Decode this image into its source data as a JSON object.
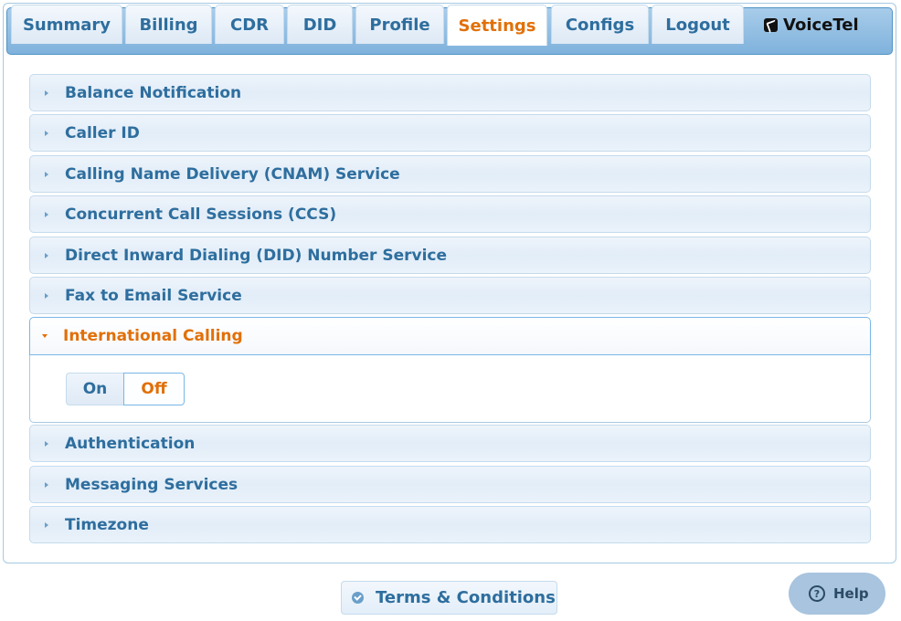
{
  "nav": {
    "tabs": [
      {
        "label": "Summary",
        "active": false
      },
      {
        "label": "Billing",
        "active": false
      },
      {
        "label": "CDR",
        "active": false
      },
      {
        "label": "DID",
        "active": false
      },
      {
        "label": "Profile",
        "active": false
      },
      {
        "label": "Settings",
        "active": true
      },
      {
        "label": "Configs",
        "active": false
      },
      {
        "label": "Logout",
        "active": false
      }
    ],
    "brand": "VoiceTel",
    "brand_icon": "phone-icon"
  },
  "settings": {
    "sections": [
      {
        "title": "Balance Notification",
        "expanded": false
      },
      {
        "title": "Caller ID",
        "expanded": false
      },
      {
        "title": "Calling Name Delivery (CNAM) Service",
        "expanded": false
      },
      {
        "title": "Concurrent Call Sessions (CCS)",
        "expanded": false
      },
      {
        "title": "Direct Inward Dialing (DID) Number Service",
        "expanded": false
      },
      {
        "title": "Fax to Email Service",
        "expanded": false
      },
      {
        "title": "International Calling",
        "expanded": true
      },
      {
        "title": "Authentication",
        "expanded": false
      },
      {
        "title": "Messaging Services",
        "expanded": false
      },
      {
        "title": "Timezone",
        "expanded": false
      }
    ],
    "international": {
      "on_label": "On",
      "off_label": "Off",
      "selected": "Off"
    }
  },
  "footer": {
    "terms_label": "Terms & Conditions",
    "terms_icon": "check-circle-icon",
    "help_label": "Help",
    "help_icon": "question-circle-icon"
  },
  "colors": {
    "accent": "#e17009",
    "text": "#2e6e9e",
    "border": "#a6c9e2",
    "tabbar": "#7fb2dc"
  }
}
